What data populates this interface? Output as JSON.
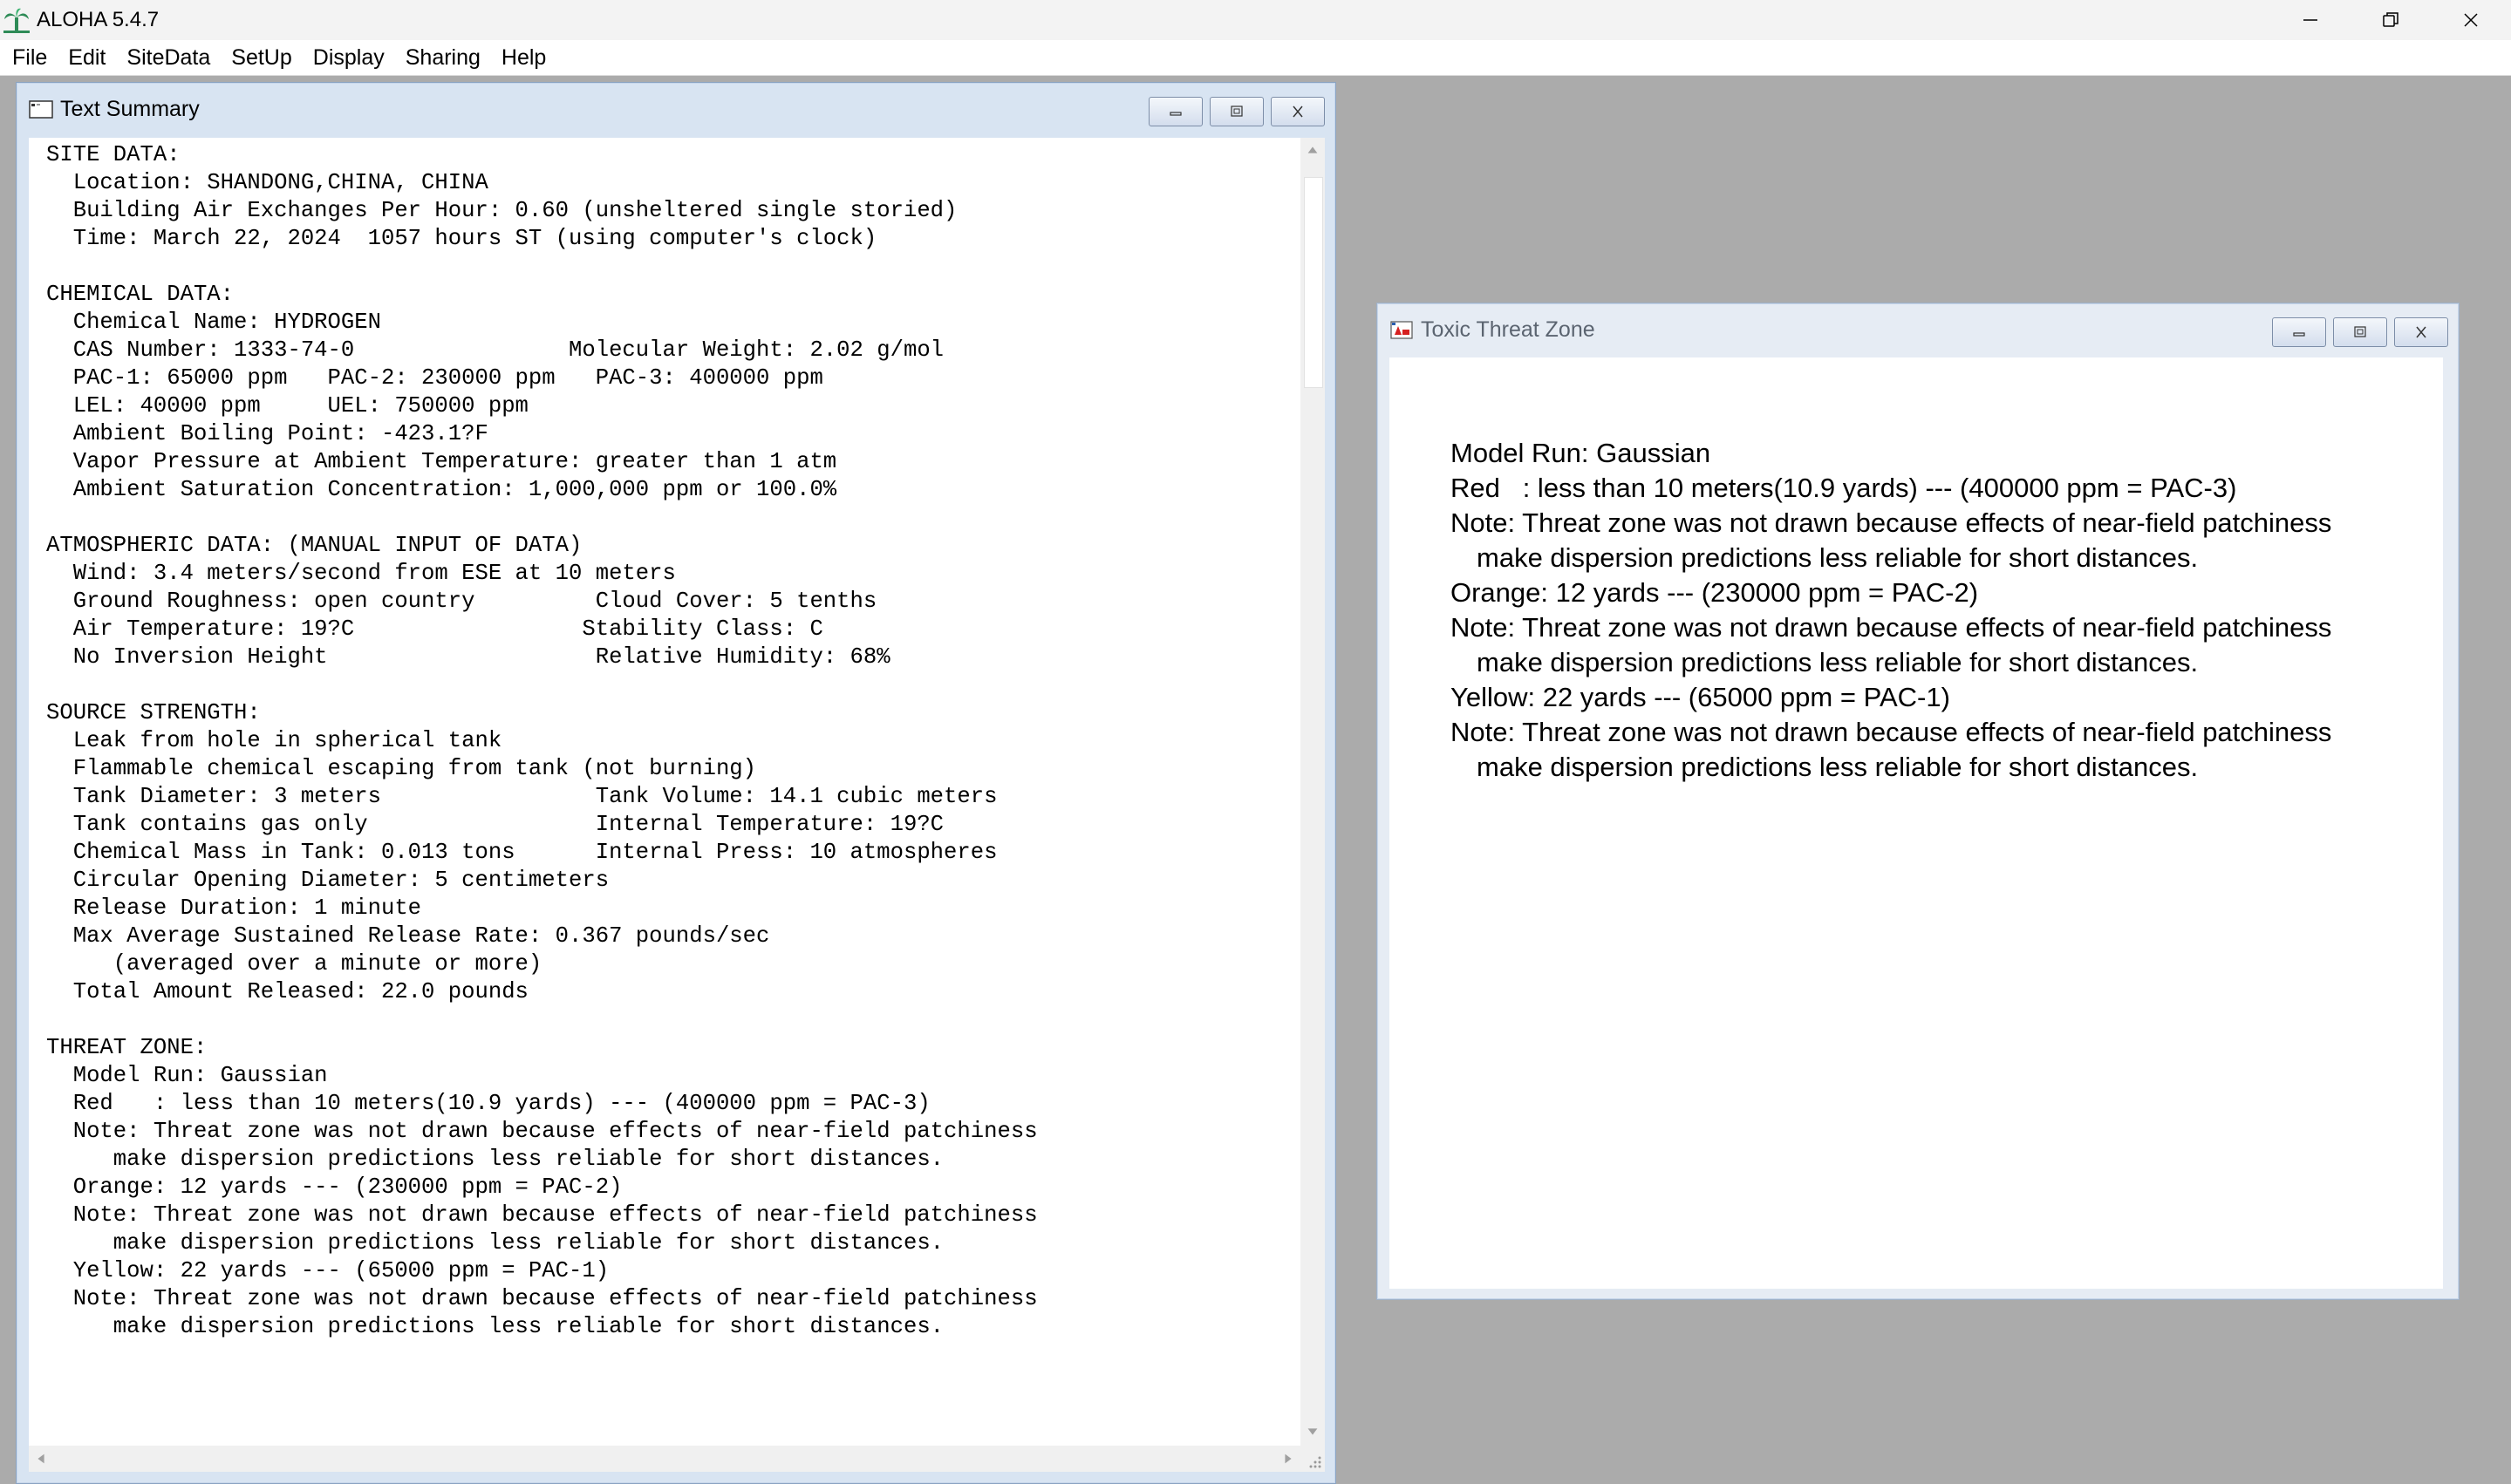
{
  "app": {
    "title": "ALOHA 5.4.7",
    "controls": [
      "minimize-icon",
      "restore-icon",
      "close-icon"
    ]
  },
  "menu": [
    "File",
    "Edit",
    "SiteData",
    "SetUp",
    "Display",
    "Sharing",
    "Help"
  ],
  "text_summary": {
    "title": "Text Summary",
    "lines": [
      "SITE DATA:",
      "  Location: SHANDONG,CHINA, CHINA",
      "  Building Air Exchanges Per Hour: 0.60 (unsheltered single storied)",
      "  Time: March 22, 2024  1057 hours ST (using computer's clock)",
      "",
      "CHEMICAL DATA:",
      "  Chemical Name: HYDROGEN",
      "  CAS Number: 1333-74-0                Molecular Weight: 2.02 g/mol",
      "  PAC-1: 65000 ppm   PAC-2: 230000 ppm   PAC-3: 400000 ppm",
      "  LEL: 40000 ppm     UEL: 750000 ppm",
      "  Ambient Boiling Point: -423.1?F",
      "  Vapor Pressure at Ambient Temperature: greater than 1 atm",
      "  Ambient Saturation Concentration: 1,000,000 ppm or 100.0%",
      "",
      "ATMOSPHERIC DATA: (MANUAL INPUT OF DATA)",
      "  Wind: 3.4 meters/second from ESE at 10 meters",
      "  Ground Roughness: open country         Cloud Cover: 5 tenths",
      "  Air Temperature: 19?C                 Stability Class: C",
      "  No Inversion Height                    Relative Humidity: 68%",
      "",
      "SOURCE STRENGTH:",
      "  Leak from hole in spherical tank",
      "  Flammable chemical escaping from tank (not burning)",
      "  Tank Diameter: 3 meters                Tank Volume: 14.1 cubic meters",
      "  Tank contains gas only                 Internal Temperature: 19?C",
      "  Chemical Mass in Tank: 0.013 tons      Internal Press: 10 atmospheres",
      "  Circular Opening Diameter: 5 centimeters",
      "  Release Duration: 1 minute",
      "  Max Average Sustained Release Rate: 0.367 pounds/sec",
      "     (averaged over a minute or more)",
      "  Total Amount Released: 22.0 pounds",
      "",
      "THREAT ZONE:",
      "  Model Run: Gaussian",
      "  Red   : less than 10 meters(10.9 yards) --- (400000 ppm = PAC-3)",
      "  Note: Threat zone was not drawn because effects of near-field patchiness",
      "     make dispersion predictions less reliable for short distances.",
      "  Orange: 12 yards --- (230000 ppm = PAC-2)",
      "  Note: Threat zone was not drawn because effects of near-field patchiness",
      "     make dispersion predictions less reliable for short distances.",
      "  Yellow: 22 yards --- (65000 ppm = PAC-1)",
      "  Note: Threat zone was not drawn because effects of near-field patchiness",
      "     make dispersion predictions less reliable for short distances."
    ]
  },
  "toxic_threat_zone": {
    "title": "Toxic Threat Zone",
    "lines": [
      {
        "text": "Model Run: Gaussian",
        "indent": false
      },
      {
        "text": "Red   : less than 10 meters(10.9 yards) --- (400000 ppm = PAC-3)",
        "indent": false
      },
      {
        "text": "Note: Threat zone was not drawn because effects of near-field patchiness",
        "indent": false
      },
      {
        "text": "make dispersion predictions less reliable for short distances.",
        "indent": true
      },
      {
        "text": "Orange: 12 yards --- (230000 ppm = PAC-2)",
        "indent": false
      },
      {
        "text": "Note: Threat zone was not drawn because effects of near-field patchiness",
        "indent": false
      },
      {
        "text": "make dispersion predictions less reliable for short distances.",
        "indent": true
      },
      {
        "text": "Yellow: 22 yards --- (65000 ppm = PAC-1)",
        "indent": false
      },
      {
        "text": "Note: Threat zone was not drawn because effects of near-field patchiness",
        "indent": false
      },
      {
        "text": "make dispersion predictions less reliable for short distances.",
        "indent": true
      }
    ]
  },
  "colors": {
    "mdi_background": "#ababab",
    "child_frame": "#d8e4f2",
    "app_icon_green": "#2e8b57"
  }
}
